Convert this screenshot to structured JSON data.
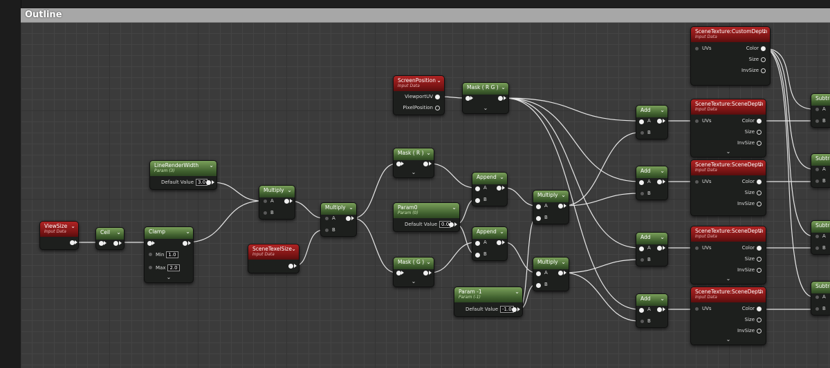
{
  "graph": {
    "title": "Outline"
  },
  "nodes": {
    "viewsize": {
      "title": "ViewSize",
      "subtitle": "Input Data"
    },
    "ceil": {
      "title": "Ceil"
    },
    "clamp": {
      "title": "Clamp",
      "min_label": "Min",
      "min_value": "1.0",
      "max_label": "Max",
      "max_value": "2.0"
    },
    "linerenderwidth": {
      "title": "LineRenderWidth",
      "subtitle": "Param (3)",
      "default_label": "Default Value",
      "default_value": "3.0"
    },
    "multiply1": {
      "title": "Multiply",
      "a": "A",
      "b": "B"
    },
    "scenetexelsize": {
      "title": "SceneTexelSize",
      "subtitle": "Input Data"
    },
    "multiply2": {
      "title": "Multiply",
      "a": "A",
      "b": "B"
    },
    "maskr": {
      "title": "Mask ( R )"
    },
    "maskg": {
      "title": "Mask ( G )"
    },
    "param0": {
      "title": "Param0",
      "subtitle": "Param (0)",
      "default_label": "Default Value",
      "default_value": "0.0"
    },
    "append1": {
      "title": "Append",
      "a": "A",
      "b": "B"
    },
    "append2": {
      "title": "Append",
      "a": "A",
      "b": "B"
    },
    "screenposition": {
      "title": "ScreenPosition",
      "subtitle": "Input Data",
      "out1": "ViewportUV",
      "out2": "PixelPosition"
    },
    "maskrg": {
      "title": "Mask ( R G )"
    },
    "paramneg1": {
      "title": "Param -1",
      "subtitle": "Param (-1)",
      "default_label": "Default Value",
      "default_value": "-1.0"
    },
    "multiply3": {
      "title": "Multiply",
      "a": "A",
      "b": "B"
    },
    "multiply4": {
      "title": "Multiply",
      "a": "A",
      "b": "B"
    },
    "add1": {
      "title": "Add",
      "a": "A",
      "b": "B"
    },
    "add2": {
      "title": "Add",
      "a": "A",
      "b": "B"
    },
    "add3": {
      "title": "Add",
      "a": "A",
      "b": "B"
    },
    "add4": {
      "title": "Add",
      "a": "A",
      "b": "B"
    },
    "sc_custom": {
      "title": "SceneTexture:CustomDepth",
      "subtitle": "Input Data",
      "in": "UVs",
      "color": "Color",
      "size": "Size",
      "invsize": "InvSize"
    },
    "sc_depth1": {
      "title": "SceneTexture:SceneDepth",
      "subtitle": "Input Data",
      "in": "UVs",
      "color": "Color",
      "size": "Size",
      "invsize": "InvSize"
    },
    "sc_depth2": {
      "title": "SceneTexture:SceneDepth",
      "subtitle": "Input Data",
      "in": "UVs",
      "color": "Color",
      "size": "Size",
      "invsize": "InvSize"
    },
    "sc_depth3": {
      "title": "SceneTexture:SceneDepth",
      "subtitle": "Input Data",
      "in": "UVs",
      "color": "Color",
      "size": "Size",
      "invsize": "InvSize"
    },
    "sc_depth4": {
      "title": "SceneTexture:SceneDepth",
      "subtitle": "Input Data",
      "in": "UVs",
      "color": "Color",
      "size": "Size",
      "invsize": "InvSize"
    },
    "subtract1": {
      "title": "Subtra",
      "a": "A",
      "b": "B"
    },
    "subtract2": {
      "title": "Subtra",
      "a": "A",
      "b": "B"
    },
    "subtract3": {
      "title": "Subtra",
      "a": "A",
      "b": "B"
    },
    "subtract4": {
      "title": "Subtra",
      "a": "A",
      "b": "B"
    }
  },
  "colors": {
    "param_header": "#4f7a3a",
    "input_header": "#8a1a1a",
    "wire": "#ffffff",
    "canvas": "#3b3b3b"
  }
}
